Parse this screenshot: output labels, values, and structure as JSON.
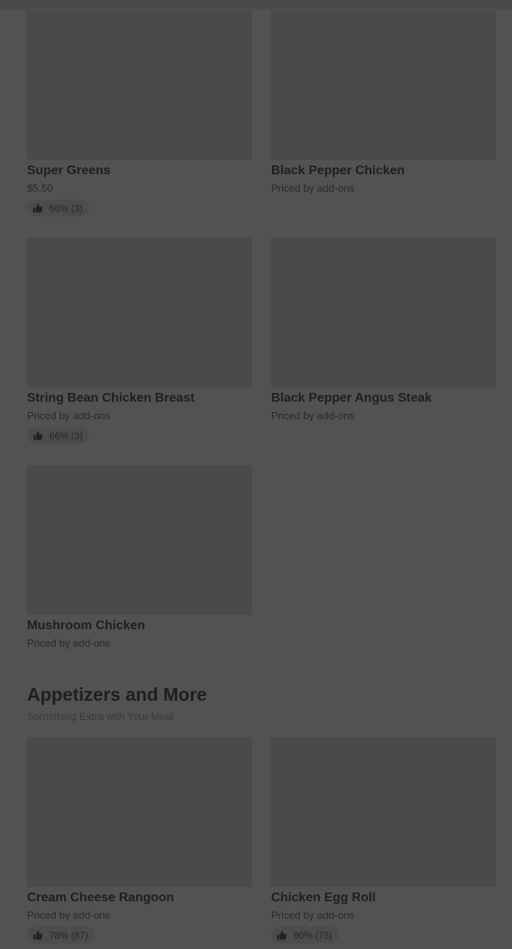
{
  "colors": {
    "overlay_background": "#525252",
    "image_placeholder": "#4a4a4a",
    "text_primary": "#1f1f1f",
    "text_secondary": "#2a2a2a",
    "rating_pill": "#4c4c4c"
  },
  "items": [
    {
      "name": "Super Greens",
      "price": "$5.50",
      "rating": "66% (3)",
      "rating_icon": "thumbs-up-icon"
    },
    {
      "name": "Black Pepper Chicken",
      "price": "Priced by add-ons"
    },
    {
      "name": "String Bean Chicken Breast",
      "price": "Priced by add-ons",
      "rating": "66% (3)",
      "rating_icon": "thumbs-up-icon"
    },
    {
      "name": "Black Pepper Angus Steak",
      "price": "Priced by add-ons"
    },
    {
      "name": "Mushroom Chicken",
      "price": "Priced by add-ons"
    }
  ],
  "appetizers": {
    "title": "Appetizers and More",
    "subtitle": "Something Extra with Your Meal",
    "items": [
      {
        "name": "Cream Cheese Rangoon",
        "price": "Priced by add-ons",
        "rating": "78% (87)",
        "rating_icon": "thumbs-up-icon"
      },
      {
        "name": "Chicken Egg Roll",
        "price": "Priced by add-ons",
        "rating": "90% (73)",
        "rating_icon": "thumbs-up-icon"
      }
    ]
  }
}
